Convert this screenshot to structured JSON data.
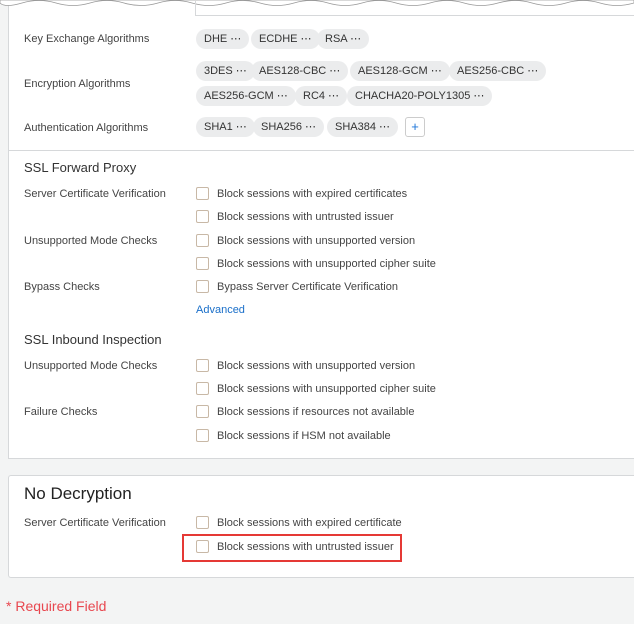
{
  "algorithms": {
    "key_exchange": {
      "label": "Key Exchange Algorithms",
      "chips": [
        "DHE ⋯",
        "ECDHE ⋯",
        "RSA ⋯"
      ]
    },
    "encryption": {
      "label": "Encryption Algorithms",
      "chips": [
        "3DES ⋯",
        "AES128-CBC ⋯",
        "AES128-GCM ⋯",
        "AES256-CBC ⋯",
        "AES256-GCM ⋯",
        "RC4 ⋯",
        "CHACHA20-POLY1305 ⋯"
      ]
    },
    "authentication": {
      "label": "Authentication Algorithms",
      "chips": [
        "SHA1 ⋯",
        "SHA256 ⋯",
        "SHA384 ⋯"
      ],
      "add": "+"
    }
  },
  "forward_proxy": {
    "title": "SSL Forward Proxy",
    "server_cert": "Server Certificate Verification",
    "cert_opts": [
      "Block sessions with expired certificates",
      "Block sessions with untrusted issuer"
    ],
    "unsupported": "Unsupported Mode Checks",
    "unsup_opts": [
      "Block sessions with unsupported version",
      "Block sessions with unsupported cipher suite"
    ],
    "bypass": "Bypass Checks",
    "bypass_opts": [
      "Bypass Server Certificate Verification"
    ],
    "advanced": "Advanced"
  },
  "inbound": {
    "title": "SSL Inbound Inspection",
    "unsupported": "Unsupported Mode Checks",
    "unsup_opts": [
      "Block sessions with unsupported version",
      "Block sessions with unsupported cipher suite"
    ],
    "failure": "Failure Checks",
    "failure_opts": [
      "Block sessions if resources not available",
      "Block sessions if HSM not available"
    ]
  },
  "no_decryption": {
    "title": "No Decryption",
    "server_cert": "Server Certificate Verification",
    "opts": [
      "Block sessions with expired certificate",
      "Block sessions with untrusted issuer"
    ]
  },
  "required": "* Required Field",
  "highlight_color": "#e53935"
}
